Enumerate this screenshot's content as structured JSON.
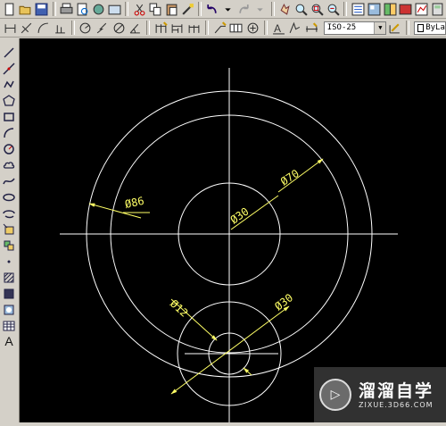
{
  "toolbar_top": {
    "icons": [
      "new-icon",
      "open-icon",
      "save-icon",
      "print-icon",
      "preview-icon",
      "publish-icon",
      "plot-icon",
      "cut-icon",
      "copy-icon",
      "paste-icon",
      "match-properties-icon",
      "undo-icon",
      "redo-icon",
      "distance-icon",
      "pan-icon",
      "zoom-realtime-icon",
      "zoom-window-icon",
      "properties-icon",
      "design-center-icon",
      "tool-palettes-icon",
      "sheet-set-icon"
    ]
  },
  "toolbar_dim": {
    "dimstyle_value": "ISO-25",
    "layer_value": "ByLa"
  },
  "left_toolbar": {
    "text_tool_glyph": "A"
  },
  "drawing": {
    "labels": {
      "outer_diameter": "Ø86",
      "ring_diameter": "Ø70",
      "center_hole": "Ø30",
      "small_boss": "Ø30",
      "small_hole": "Ø12"
    },
    "line_color": "#ffffff",
    "dim_color": "#ffff66"
  },
  "watermark": {
    "title": "溜溜自学",
    "url": "ZIXUE.3D66.COM",
    "logo_glyph": "▷"
  }
}
